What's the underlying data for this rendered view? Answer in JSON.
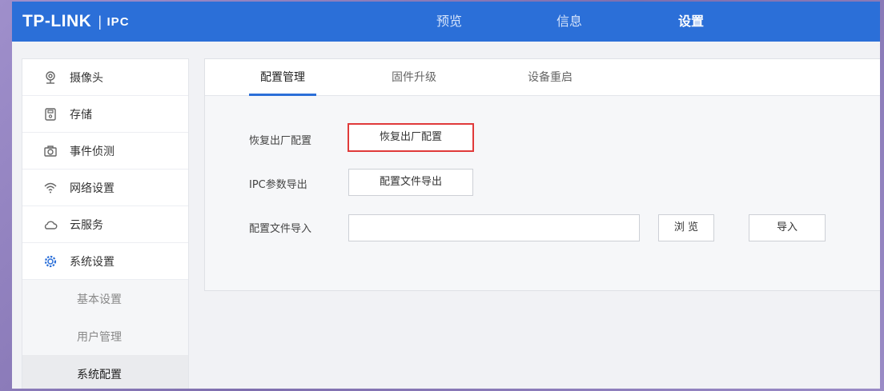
{
  "header": {
    "logo_main": "TP-LINK",
    "logo_sep": "|",
    "logo_sub": "IPC",
    "nav": [
      {
        "label": "预览"
      },
      {
        "label": "信息"
      },
      {
        "label": "设置",
        "active": true
      }
    ]
  },
  "sidebar": {
    "items": [
      {
        "label": "摄像头",
        "icon": "camera-icon"
      },
      {
        "label": "存储",
        "icon": "storage-icon"
      },
      {
        "label": "事件侦测",
        "icon": "event-detection-icon"
      },
      {
        "label": "网络设置",
        "icon": "wifi-icon"
      },
      {
        "label": "云服务",
        "icon": "cloud-icon"
      },
      {
        "label": "系统设置",
        "icon": "settings-gear-icon",
        "active": true
      }
    ],
    "subitems": [
      {
        "label": "基本设置"
      },
      {
        "label": "用户管理"
      },
      {
        "label": "系统配置",
        "active": true
      }
    ]
  },
  "tabs": [
    {
      "label": "配置管理",
      "active": true
    },
    {
      "label": "固件升级"
    },
    {
      "label": "设备重启"
    }
  ],
  "form": {
    "factory_reset_label": "恢复出厂配置",
    "factory_reset_button": "恢复出厂配置",
    "export_label": "IPC参数导出",
    "export_button": "配置文件导出",
    "import_label": "配置文件导入",
    "import_file_value": "",
    "browse_button": "浏 览",
    "import_button": "导入"
  },
  "colors": {
    "header_bg": "#2b6fd8",
    "active_tab_underline": "#2b6fd8",
    "highlight_border": "#e03a3a"
  }
}
